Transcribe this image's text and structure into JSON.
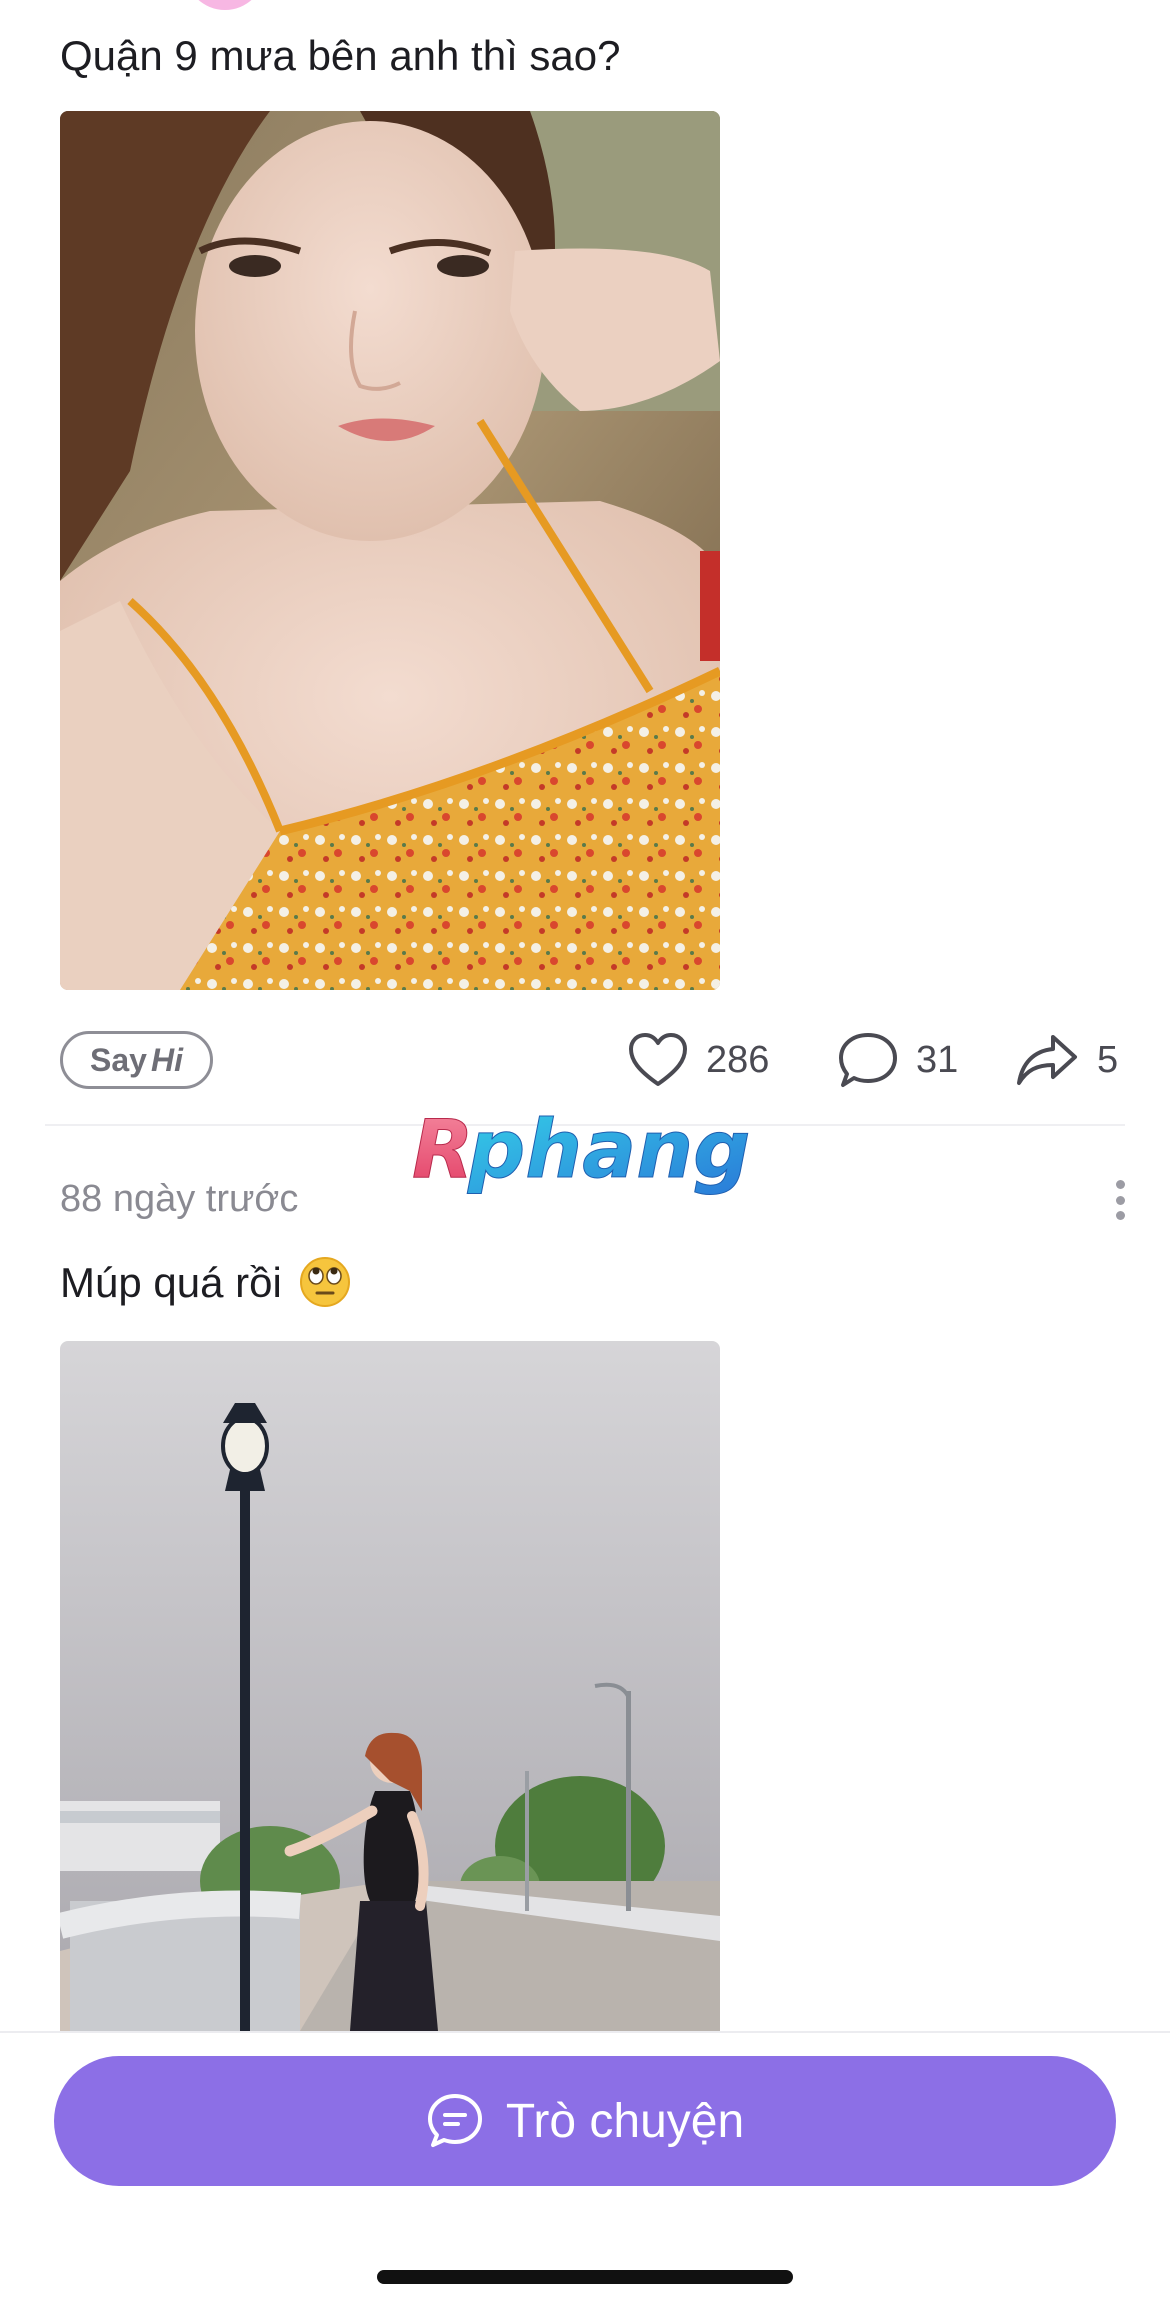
{
  "post1": {
    "caption": "Quận 9 mưa bên anh thì sao?",
    "photo_alt": "photo-selfie",
    "actions": {
      "sayhi_say": "Say",
      "sayhi_hi": "Hi",
      "likes": "286",
      "comments": "31",
      "shares": "5"
    }
  },
  "watermark": {
    "text": "Rphang"
  },
  "post2": {
    "time": "88 ngày trước",
    "caption": "Múp quá rồi",
    "emoji": "eye-roll-emoji"
  },
  "bottom_bar": {
    "chat_label": "Trò chuyện"
  },
  "colors": {
    "accent": "#8c6fe6",
    "text_primary": "#1d1d22",
    "text_secondary": "#8a8a92",
    "icon": "#4a4a52"
  }
}
